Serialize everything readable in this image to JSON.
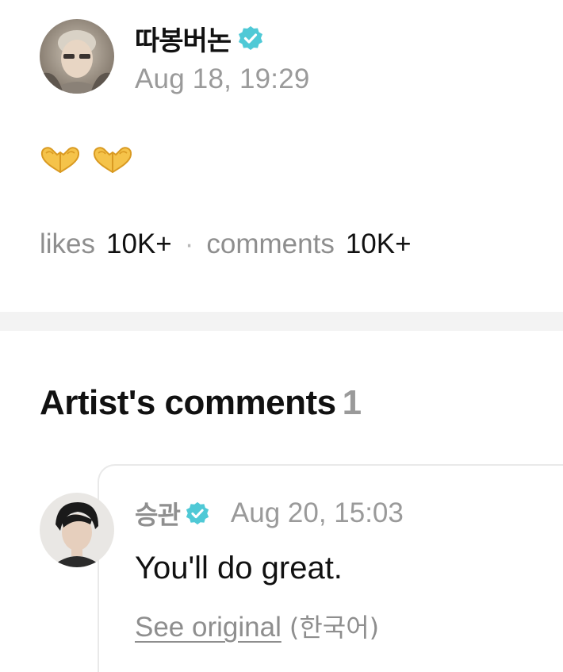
{
  "post": {
    "author": "따봉버논",
    "timestamp": "Aug 18, 19:29",
    "content_emoji": [
      "heart-hands",
      "heart-hands"
    ],
    "likes_label": "likes",
    "likes_value": "10K+",
    "separator": "·",
    "comments_label": "comments",
    "comments_value": "10K+",
    "verified_color": "#4fc9d6"
  },
  "artist_comments": {
    "title": "Artist's comments",
    "count": "1",
    "items": [
      {
        "author": "승관",
        "timestamp": "Aug 20, 15:03",
        "text": "You'll do great.",
        "see_original": "See original",
        "language": "(한국어)"
      }
    ]
  }
}
